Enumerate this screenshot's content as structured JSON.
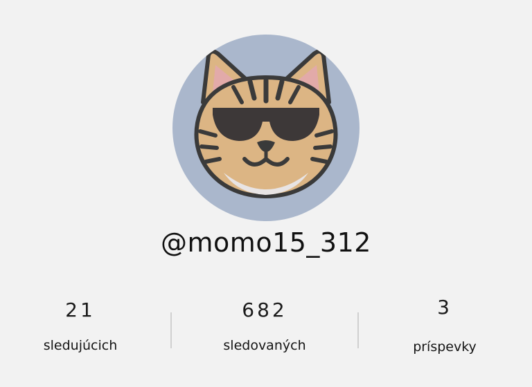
{
  "profile": {
    "avatar_icon": "sunglasses-cat-icon",
    "avatar_bg": "#aab7cc",
    "username": "@momo15_312"
  },
  "stats": {
    "followers": {
      "count": "21",
      "label": "sledujúcich"
    },
    "following": {
      "count": "682",
      "label": "sledovaných"
    },
    "posts": {
      "count": "3",
      "label": "príspevky"
    }
  }
}
